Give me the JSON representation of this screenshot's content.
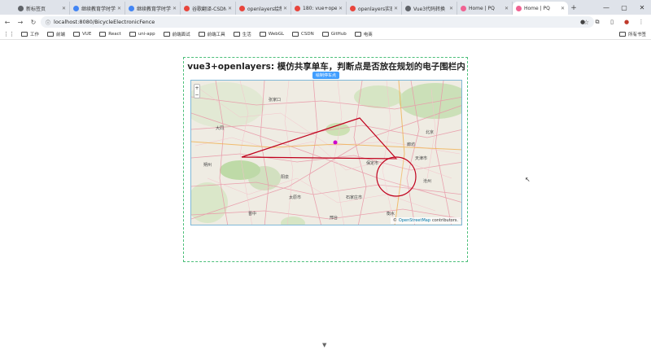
{
  "tabs": [
    {
      "title": "新标签页",
      "color": "#5f6368"
    },
    {
      "title": "继续教育学时学习",
      "color": "#4285f4"
    },
    {
      "title": "继续教育学时学习",
      "color": "#4285f4"
    },
    {
      "title": "谷歌翻译-CSDN",
      "color": "#e8453c"
    },
    {
      "title": "openlayers绘制",
      "color": "#e8453c"
    },
    {
      "title": "180: vue+openl",
      "color": "#e8453c"
    },
    {
      "title": "openlayers实现",
      "color": "#e8453c"
    },
    {
      "title": "Vue3代码转换",
      "color": "#5f6368"
    },
    {
      "title": "Home | PQ",
      "color": "#f06292"
    },
    {
      "title": "Home | PQ",
      "color": "#f06292",
      "active": true
    }
  ],
  "address": {
    "url": "localhost:8080/BicycleElectronicFence"
  },
  "bookmarks": [
    "工作",
    "前端",
    "VUE",
    "React",
    "uni-app",
    "前端面试",
    "前端工具",
    "生活",
    "WebGL",
    "CSDN",
    "GitHub",
    "电商"
  ],
  "bookmarks_all": "所有书签",
  "page": {
    "title": "vue3+openlayers: 模仿共享单车，判断点是否放在规划的电子围栏内",
    "draw_button": "绘制停车点"
  },
  "map": {
    "zoom_in": "+",
    "zoom_out": "−",
    "attribution_prefix": "©",
    "attribution_link": "OpenStreetMap",
    "attribution_suffix": "contributors.",
    "place_labels": [
      "天津市",
      "北京",
      "廊坊",
      "保定市",
      "石家庄市",
      "沧州",
      "衡水",
      "张家口",
      "大同",
      "太原市",
      "邢台",
      "朔州",
      "阳泉",
      "晋中"
    ],
    "fence_color": "#c0001c",
    "point_color": "#cc00cc"
  }
}
